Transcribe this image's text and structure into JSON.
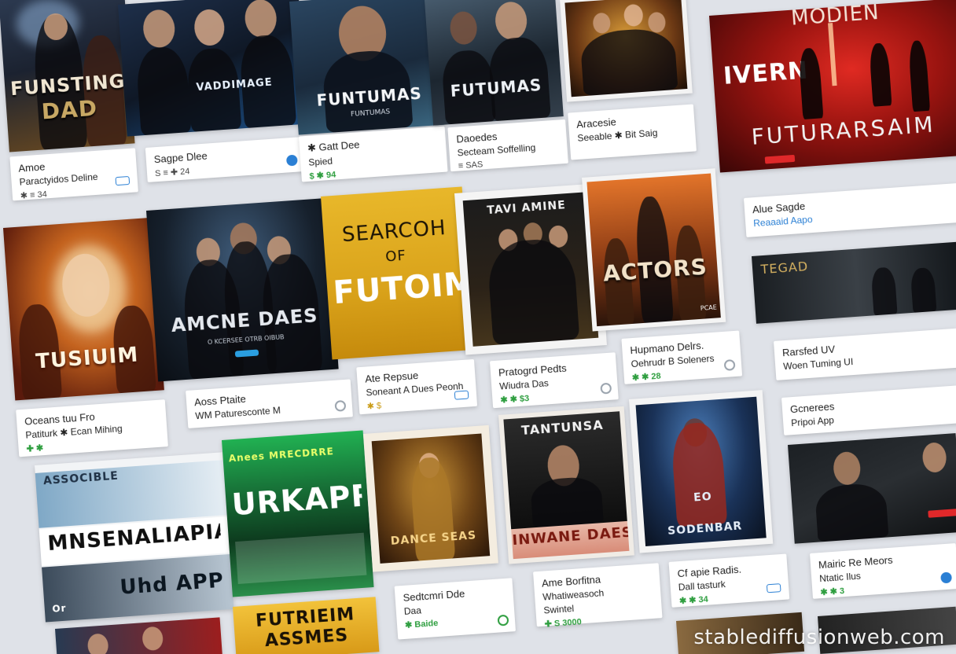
{
  "posters": {
    "p1": {
      "title": "FUNSTING",
      "title2": "DAD"
    },
    "p2": {
      "title": "VADDIMAGE"
    },
    "p3": {
      "title": "FUNTUMAS",
      "subtitle": "FUNTUMAS"
    },
    "p4": {
      "title": "FUTUMAS"
    },
    "p6": {
      "title_top": "MODIEN",
      "title_mid": "IVERN",
      "title_main": "FUTURARSAIM"
    },
    "p7": {
      "title": "TUSIUIM"
    },
    "p8": {
      "title": "AMCNE DAES",
      "subtitle": "O KCERSEE  OTRB  OIBUB"
    },
    "p9": {
      "title_top": "SEARCOH",
      "title_mid": "OF",
      "title_main": "FUTOIM"
    },
    "p10": {
      "title": "TAVI AMINE"
    },
    "p11": {
      "title": "ACTORS",
      "badge": "PCAE"
    },
    "p12": {
      "title": "TEGAD"
    },
    "p13": {
      "top": "ASSOCIBLE",
      "title": "MNSENALIAPIA",
      "bottom": "Uhd APP",
      "bottom_left": "Or"
    },
    "p14": {
      "top": "Anees MRECDRRE",
      "title": "URKAPR"
    },
    "p15": {
      "title": "DANCE SEAS"
    },
    "p16": {
      "title": "TANTUNSA",
      "band": "INWANE DAES"
    },
    "p17": {
      "title": "EO",
      "footer": "SODENBAR"
    },
    "p19": {
      "title": "FUTRIEIM",
      "title2": "ASSMES"
    }
  },
  "captions": {
    "c1": {
      "line1": "Amoe",
      "line2": "Paractyidos Deline",
      "meta": "✱ ≡ 34"
    },
    "c2": {
      "line1": "Sagpe Dlee",
      "meta": "S ≡ ✚ 24"
    },
    "c3": {
      "line1": "✱ Gatt Dee",
      "line2": "Spied",
      "meta": "$ ✱ 94"
    },
    "c4": {
      "line1": "Daoedes",
      "line2": "Secteam Soffelling",
      "meta": "≡ SAS"
    },
    "c5": {
      "line1": "Aracesie",
      "line2": "Seeable ✱ Bit Saig"
    },
    "c6": {
      "line1": "Alue Sagde",
      "line2": "Reaaaid Aapo"
    },
    "c7": {
      "line1": "Oceans   tuu Fro",
      "line2": "Patiturk ✱ Ecan Mihing",
      "meta": "✚ ✱"
    },
    "c8": {
      "line1": "Aoss Ptaite",
      "line2": "WM Paturesconte M"
    },
    "c9": {
      "line1": "Ate Repsue",
      "line2": "Soneant A Dues Peonh",
      "meta": "✱ $"
    },
    "c10": {
      "line1": "Pratogrd Pedts",
      "line2": "Wiudra Das",
      "meta": "✱ ✱ $3"
    },
    "c11": {
      "line1": "Hupmano Delrs.",
      "line2": "Oehrudr B Soleners",
      "meta": "✱ ✱ 28"
    },
    "c12": {
      "line1": "Rarsfed UV",
      "line2": "Woen Tuming UI"
    },
    "c13": {
      "line1": "Gcnerees",
      "line2": "Pripoi App"
    },
    "c14": {
      "line1": "Sedtcmri Dde",
      "line2": "Daa",
      "meta": "✱ Baide"
    },
    "c15": {
      "line1": "Ame Borfitna",
      "line2": "Whatiweasoch",
      "line3": "Swintel",
      "meta": "✚ S 3000"
    },
    "c16": {
      "line1": "Cf apie Radis.",
      "line2": "Dall tasturk",
      "meta": "✱ ✱ 34"
    },
    "c17": {
      "line1": "Mairic Re Meors",
      "line2": "Ntatic Ilus",
      "meta": "✱ ✱ 3"
    }
  },
  "watermark": "stablediffusionweb.com",
  "colors": {
    "background": "#dfe2e8",
    "card": "#ffffff",
    "accent_red": "#e0282a",
    "accent_blue": "#2a7fd4",
    "accent_green": "#2e9e3f",
    "gold": "#d8a71c"
  }
}
